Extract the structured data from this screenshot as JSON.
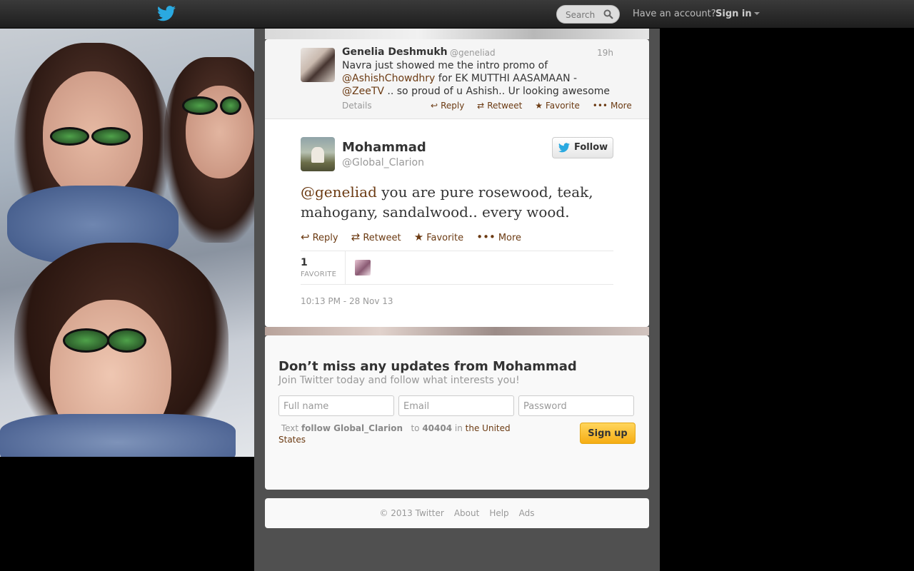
{
  "topbar": {
    "search_placeholder": "Search",
    "have_account": "Have an account?",
    "sign_in": "Sign in"
  },
  "parent_tweet": {
    "name": "Genelia Deshmukh",
    "handle": "@geneliad",
    "time": "19h",
    "text_1": "Navra just showed me the intro promo of ",
    "mention_1": "@AshishChowdhry",
    "text_2": " for EK MUTTHI AASAMAAN - ",
    "mention_2": "@ZeeTV",
    "text_3": " .. so proud of u Ashish.. Ur looking awesome",
    "details": "Details",
    "actions": {
      "reply": "Reply",
      "retweet": "Retweet",
      "favorite": "Favorite",
      "more": "More"
    }
  },
  "main_tweet": {
    "name": "Mohammad",
    "handle": "@Global_Clarion",
    "follow_label": "Follow",
    "mention": "@geneliad",
    "text": " you are pure rosewood, teak, mahogany, sandalwood.. every wood.",
    "actions": {
      "reply": "Reply",
      "retweet": "Retweet",
      "favorite": "Favorite",
      "more": "More"
    },
    "favorites_count": "1",
    "favorites_label": "FAVORITE",
    "date": "10:13 PM - 28 Nov 13"
  },
  "signup": {
    "title": "Don’t miss any updates from Mohammad",
    "subtitle": "Join Twitter today and follow what interests you!",
    "full_name_placeholder": "Full name",
    "email_placeholder": "Email",
    "password_placeholder": "Password",
    "sms_text": "Text",
    "sms_command": "follow Global_Clarion",
    "sms_to": "to",
    "sms_number": "40404",
    "sms_in": "in",
    "sms_country": "the United States",
    "button": "Sign up"
  },
  "footer": {
    "copyright": "© 2013 Twitter",
    "about": "About",
    "help": "Help",
    "ads": "Ads"
  },
  "colors": {
    "link": "#6b3a12",
    "twitter_blue": "#1da1f2",
    "signup_button": "#f6ad13"
  }
}
